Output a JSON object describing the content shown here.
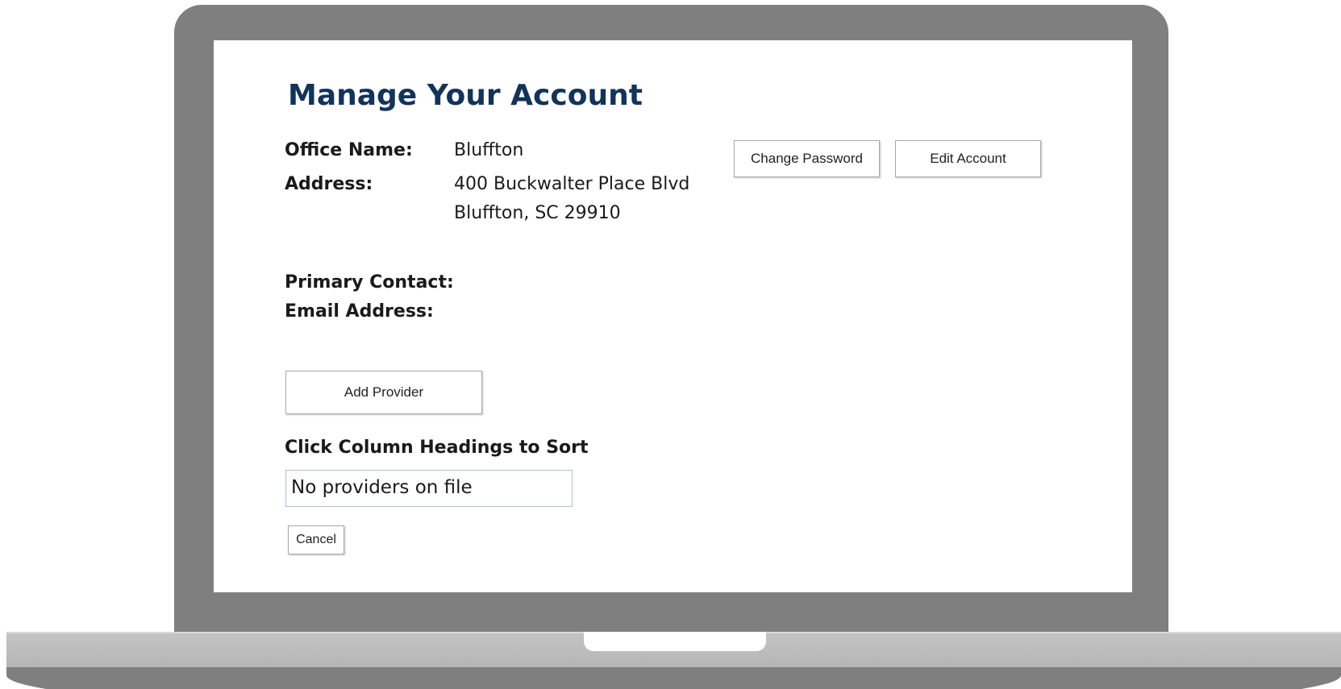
{
  "page_title": "Manage Your Account",
  "office": {
    "name_label": "Office Name:",
    "name_value": "Bluffton",
    "address_label": "Address:",
    "address_line1": "400 Buckwalter Place Blvd",
    "address_line2": "Bluffton, SC 29910",
    "primary_contact_label": "Primary Contact:",
    "email_label": "Email Address:"
  },
  "buttons": {
    "change_password": "Change Password",
    "edit_account": "Edit Account",
    "add_provider": "Add Provider",
    "cancel": "Cancel"
  },
  "providers": {
    "sort_hint": "Click Column Headings to Sort",
    "empty_message": "No providers on file"
  },
  "colors": {
    "device_frame": "#7f7f7f",
    "title": "#12335a",
    "table_border": "#a8c4dc"
  }
}
